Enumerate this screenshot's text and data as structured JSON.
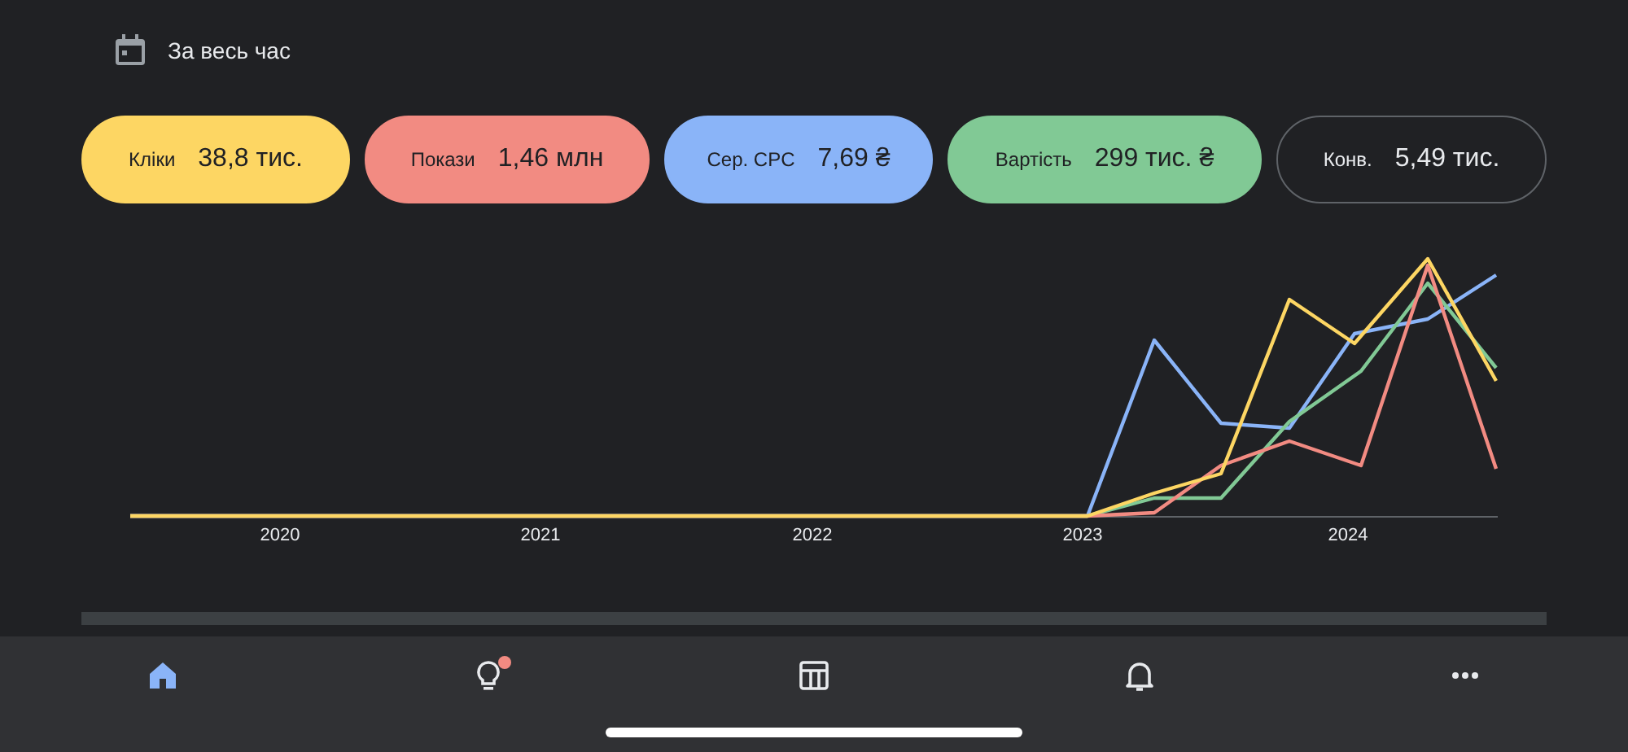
{
  "date_range": {
    "label": "За весь час"
  },
  "metrics": [
    {
      "label": "Кліки",
      "value": "38,8 тис.",
      "selected": true,
      "color": "#fdd663"
    },
    {
      "label": "Покази",
      "value": "1,46 млн",
      "selected": true,
      "color": "#f28b82"
    },
    {
      "label": "Сер. CPC",
      "value": "7,69 ₴",
      "selected": true,
      "color": "#8ab4f8"
    },
    {
      "label": "Вартість",
      "value": "299 тис. ₴",
      "selected": true,
      "color": "#81c995"
    },
    {
      "label": "Конв.",
      "value": "5,49 тис.",
      "selected": false
    }
  ],
  "chart": {
    "x_labels": [
      "2020",
      "2021",
      "2022",
      "2023",
      "2024"
    ]
  },
  "nav": [
    {
      "selected": true,
      "badge": false
    },
    {
      "selected": false,
      "badge": true
    },
    {
      "selected": false,
      "badge": false
    },
    {
      "selected": false,
      "badge": false
    },
    {
      "selected": false,
      "badge": false
    }
  ]
}
